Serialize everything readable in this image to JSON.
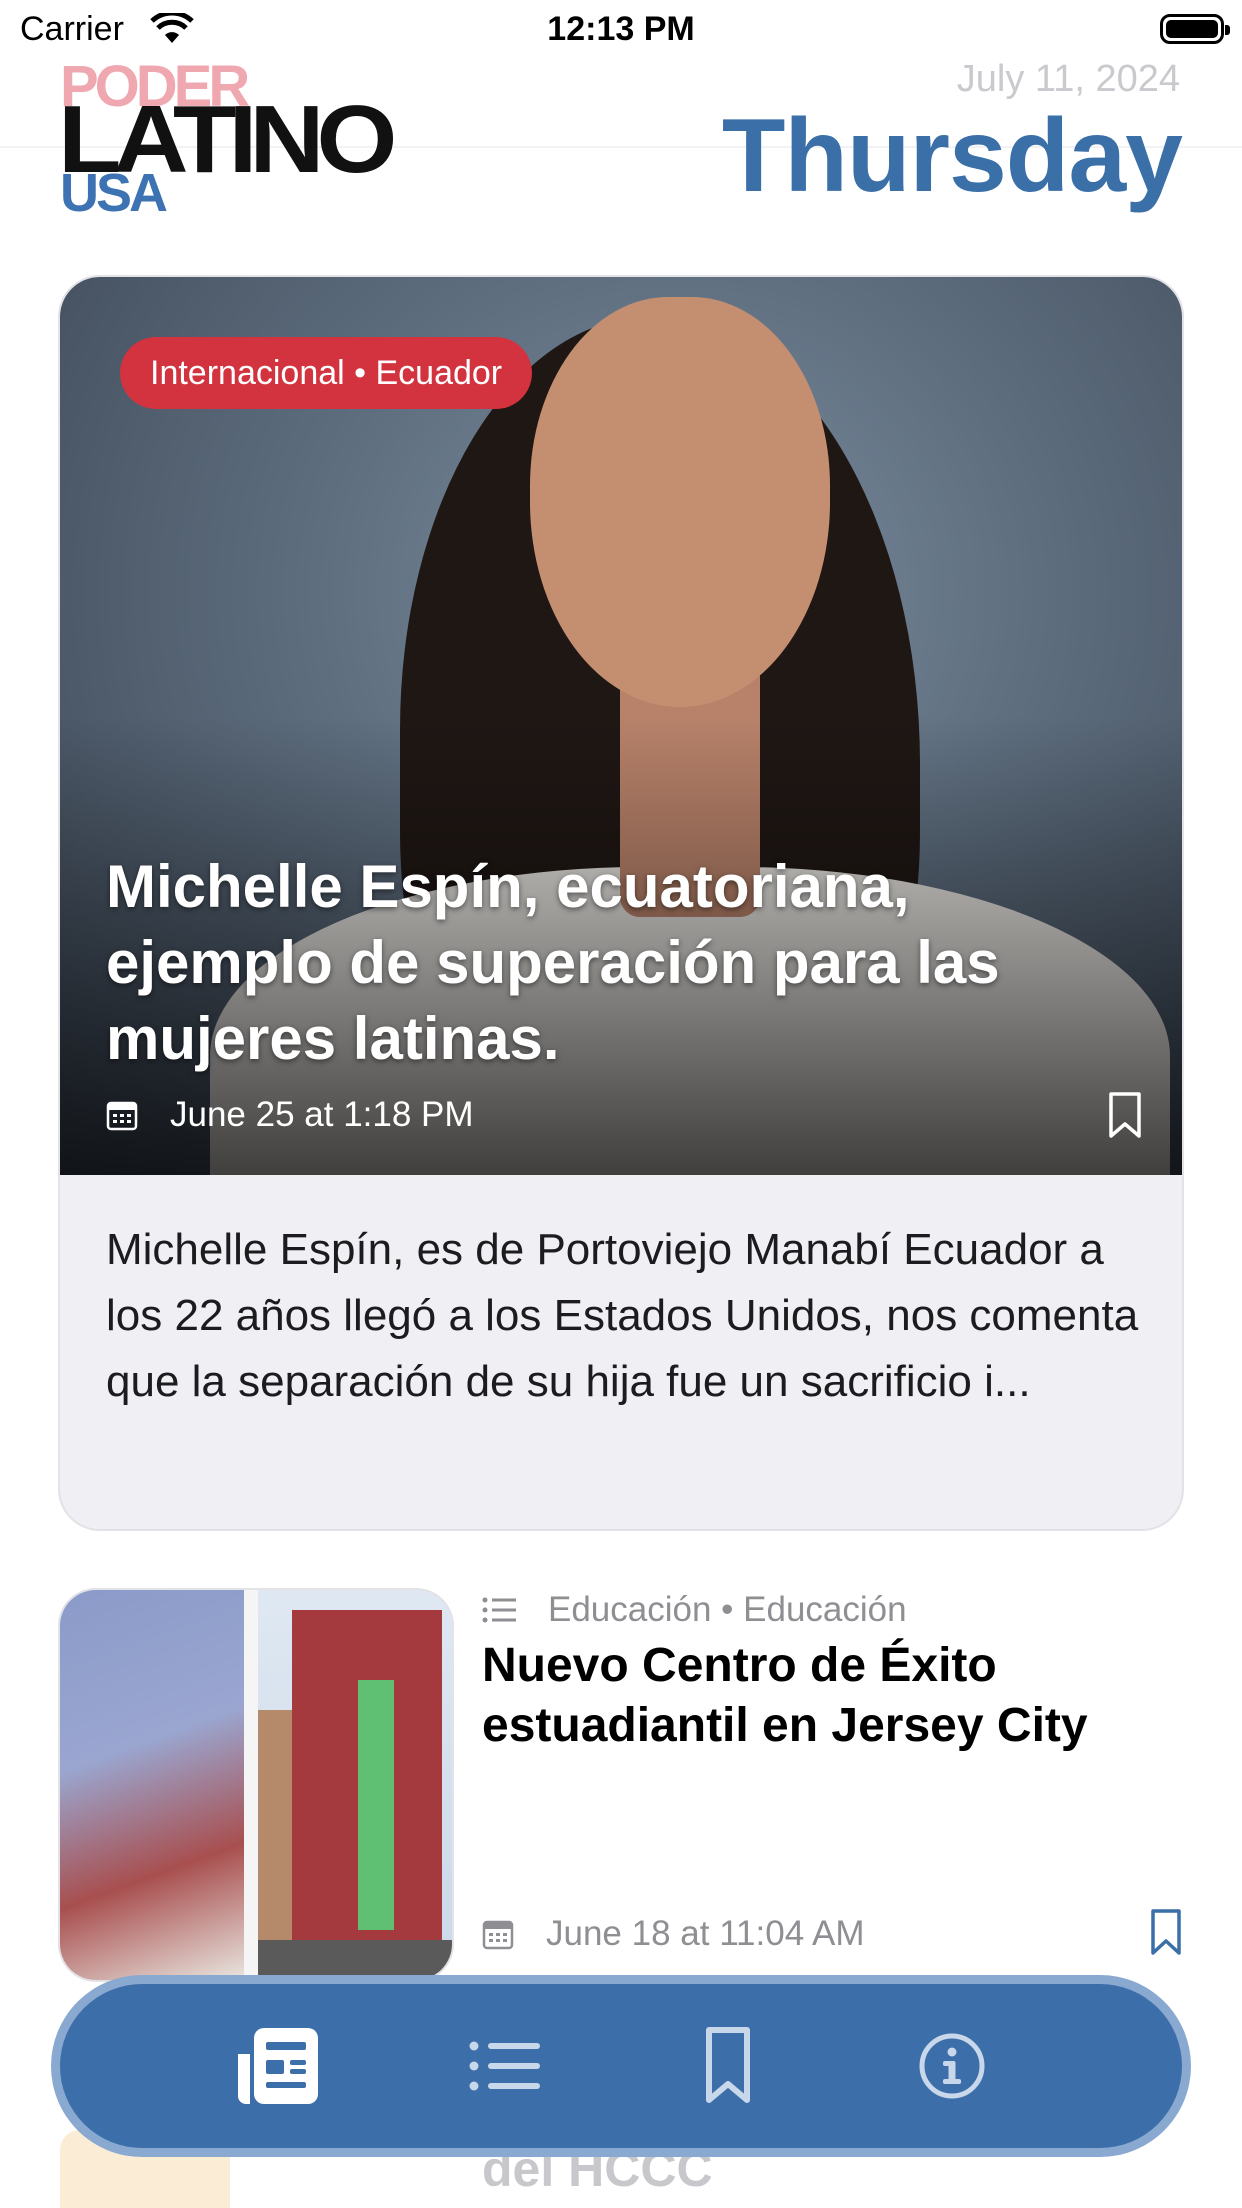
{
  "status_bar": {
    "carrier": "Carrier",
    "time": "12:13 PM"
  },
  "header": {
    "logo": {
      "line1": "PODER",
      "line2": "LATINO",
      "line3": "USA"
    },
    "date": "July 11, 2024",
    "weekday": "Thursday"
  },
  "featured": {
    "category": "Internacional • Ecuador",
    "title": "Michelle Espín, ecuatoriana, ejemplo de superación para las mujeres latinas.",
    "date": "June 25 at 1:18 PM",
    "excerpt": "Michelle Espín, es de Portoviejo Manabí Ecuador a los 22 años llegó a los Estados Unidos, nos comenta que la separación de su hija fue un sacrificio i...",
    "icons": {
      "date": "calendar-icon",
      "save": "bookmark-icon"
    }
  },
  "articles": [
    {
      "category": "Educación • Educación",
      "title": "Nuevo Centro de Éxito estuadiantil en Jersey City",
      "date": "June 18 at 11:04 AM",
      "icons": {
        "category": "list-icon",
        "date": "calendar-icon",
        "save": "bookmark-icon"
      }
    }
  ],
  "peek_article": {
    "title": "del HCCC"
  },
  "tab_bar": {
    "tabs": [
      {
        "name": "news",
        "icon": "newspaper-icon",
        "selected": true
      },
      {
        "name": "categories",
        "icon": "list-icon",
        "selected": false
      },
      {
        "name": "saved",
        "icon": "bookmark-icon",
        "selected": false
      },
      {
        "name": "info",
        "icon": "info-icon",
        "selected": false
      }
    ]
  },
  "colors": {
    "accent": "#3a6fa8",
    "category_pill": "#d2333f",
    "tab_bar": "#3c6ea9",
    "secondary_text": "#8e8e93"
  }
}
